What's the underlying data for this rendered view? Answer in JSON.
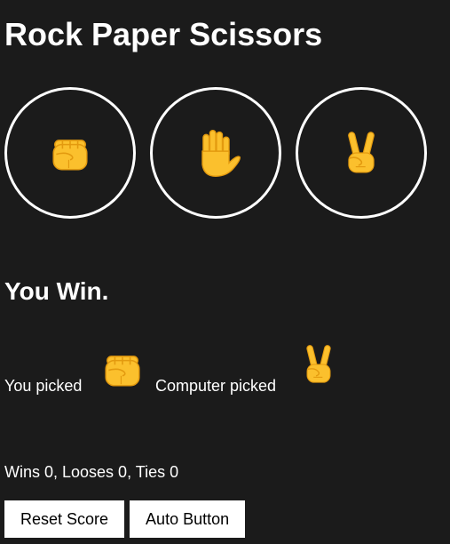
{
  "header": {
    "title": "Rock Paper Scissors"
  },
  "choices": [
    {
      "name": "rock",
      "icon": "raised-fist-icon"
    },
    {
      "name": "paper",
      "icon": "raised-hand-icon"
    },
    {
      "name": "scissors",
      "icon": "victory-hand-icon"
    }
  ],
  "result": {
    "text": "You Win."
  },
  "moves": {
    "player_label": "You picked",
    "player_icon": "raised-fist-icon",
    "computer_label": "Computer picked",
    "computer_icon": "victory-hand-icon"
  },
  "score": {
    "text": "Wins 0, Looses 0, Ties 0"
  },
  "buttons": {
    "reset_label": "Reset Score",
    "auto_label": "Auto Button"
  },
  "colors": {
    "background": "#1b1b1b",
    "emoji_yellow": "#fbc02d",
    "emoji_outline": "#e39a0f"
  }
}
